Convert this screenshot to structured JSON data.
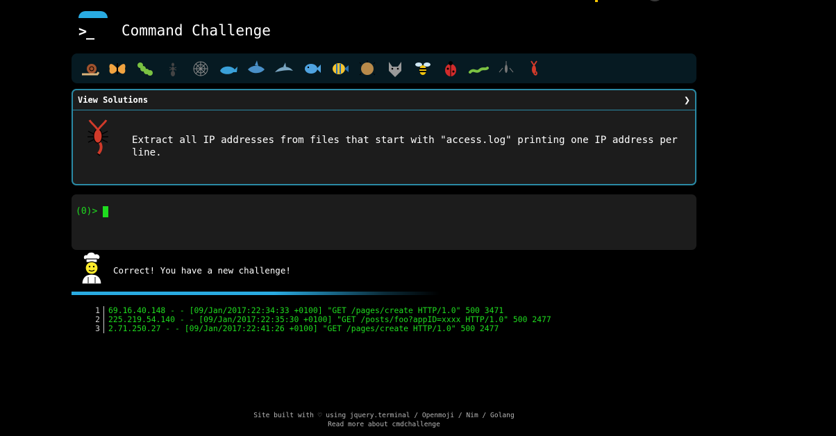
{
  "header": {
    "title": "Command Challenge",
    "logo_text": ">_"
  },
  "challenges": [
    {
      "icon": "snail-icon",
      "color": "#a0522d"
    },
    {
      "icon": "butterfly-icon",
      "color": "#f1a340"
    },
    {
      "icon": "caterpillar-icon",
      "color": "#7ac142"
    },
    {
      "icon": "ant-icon",
      "color": "#444444"
    },
    {
      "icon": "spider-web-icon",
      "color": "#8a8a8a"
    },
    {
      "icon": "whale-icon",
      "color": "#3aa0d8"
    },
    {
      "icon": "shark-icon",
      "color": "#4a90c8"
    },
    {
      "icon": "dolphin-icon",
      "color": "#7aa6c2"
    },
    {
      "icon": "fish-icon",
      "color": "#4fa3e0"
    },
    {
      "icon": "tropical-fish-icon",
      "color": "#f4c430"
    },
    {
      "icon": "blowfish-icon",
      "color": "#b88a4a"
    },
    {
      "icon": "wolf-icon",
      "color": "#9a9a9a"
    },
    {
      "icon": "bee-icon",
      "color": "#f1c40f"
    },
    {
      "icon": "ladybug-icon",
      "color": "#d22b2b"
    },
    {
      "icon": "worm-icon",
      "color": "#7ac142"
    },
    {
      "icon": "mosquito-icon",
      "color": "#777777"
    },
    {
      "icon": "scorpion-icon",
      "color": "#d03a2a"
    }
  ],
  "solutions": {
    "header_label": "View Solutions",
    "toggle": "❯",
    "task": "Extract all IP addresses from files that start with \"access.log\" printing one IP address per line."
  },
  "terminal": {
    "prompt": "(0)>"
  },
  "feedback": {
    "message": "Correct! You have a new challenge!"
  },
  "output": {
    "lines": [
      {
        "n": "1",
        "text": "69.16.40.148 - - [09/Jan/2017:22:34:33 +0100] \"GET /pages/create HTTP/1.0\" 500 3471"
      },
      {
        "n": "2",
        "text": "225.219.54.140 - - [09/Jan/2017:22:35:30 +0100] \"GET /posts/foo?appID=xxxx HTTP/1.0\" 500 2477"
      },
      {
        "n": "3",
        "text": "2.71.250.27 - - [09/Jan/2017:22:41:26 +0100] \"GET /pages/create HTTP/1.0\" 500 2477"
      }
    ]
  },
  "footer": {
    "line1": "Site built with ♡ using jquery.terminal / Openmoji / Nim / Golang",
    "line2": "Read more about cmdchallenge"
  },
  "colors": {
    "accent": "#29abe2",
    "panel_border": "#2a8aa5",
    "terminal_green": "#1fdc1f",
    "panel_bg": "#1c1c1c"
  }
}
